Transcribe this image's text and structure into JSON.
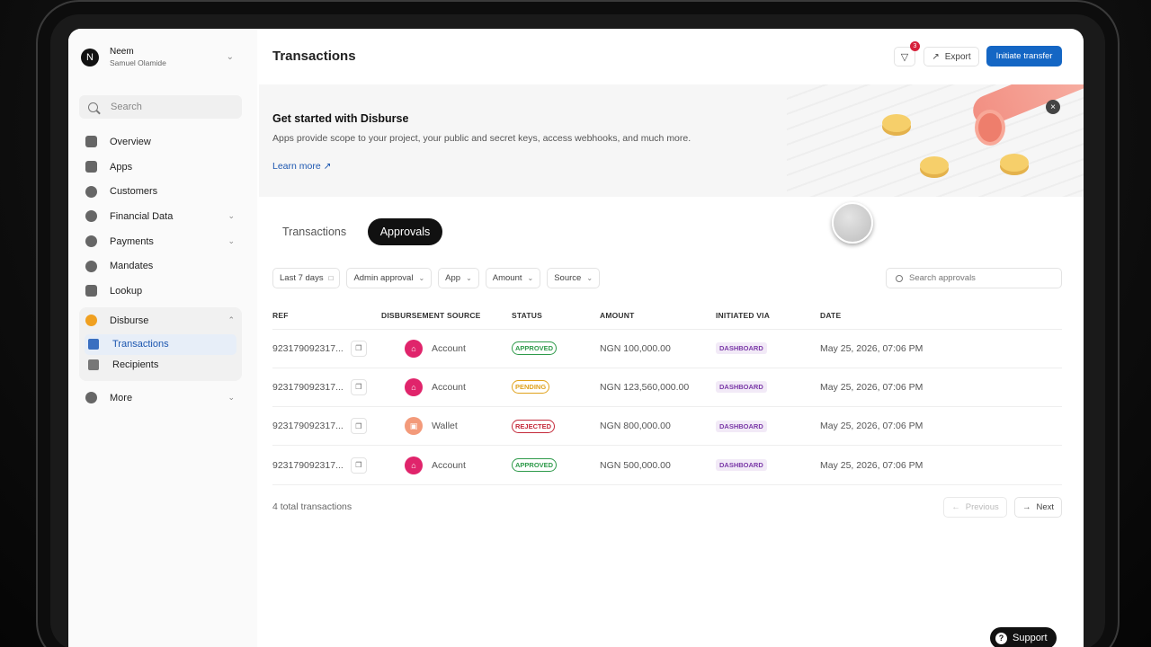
{
  "org": {
    "initial": "N",
    "name": "Neem",
    "user": "Samuel Olamide"
  },
  "sidebar": {
    "search_placeholder": "Search",
    "items": [
      {
        "label": "Overview"
      },
      {
        "label": "Apps"
      },
      {
        "label": "Customers"
      },
      {
        "label": "Financial Data"
      },
      {
        "label": "Payments"
      },
      {
        "label": "Mandates"
      },
      {
        "label": "Lookup"
      }
    ],
    "group": {
      "label": "Disburse",
      "children": [
        {
          "label": "Transactions"
        },
        {
          "label": "Recipients"
        }
      ]
    },
    "more": "More"
  },
  "header": {
    "title": "Transactions",
    "notification_count": "3",
    "export_label": "Export",
    "initiate_label": "Initiate transfer"
  },
  "banner": {
    "title": "Get started with Disburse",
    "description": "Apps provide scope to your project, your public and secret keys, access webhooks, and much more.",
    "link": "Learn more"
  },
  "tabs": [
    {
      "label": "Transactions"
    },
    {
      "label": "Approvals"
    }
  ],
  "filters": [
    {
      "label": "Last 7 days"
    },
    {
      "label": "Admin approval"
    },
    {
      "label": "App"
    },
    {
      "label": "Amount"
    },
    {
      "label": "Source"
    }
  ],
  "search_approvals_placeholder": "Search approvals",
  "table": {
    "columns": [
      "REF",
      "DISBURSEMENT SOURCE",
      "STATUS",
      "AMOUNT",
      "INITIATED VIA",
      "DATE"
    ],
    "rows": [
      {
        "ref": "923179092317...",
        "source": "Account",
        "status": "APPROVED",
        "amount": "NGN 100,000.00",
        "via": "DASHBOARD",
        "date": "May 25, 2026, 07:06 PM"
      },
      {
        "ref": "923179092317...",
        "source": "Account",
        "status": "PENDING",
        "amount": "NGN 123,560,000.00",
        "via": "DASHBOARD",
        "date": "May 25, 2026, 07:06 PM"
      },
      {
        "ref": "923179092317...",
        "source": "Wallet",
        "status": "REJECTED",
        "amount": "NGN 800,000.00",
        "via": "DASHBOARD",
        "date": "May 25, 2026, 07:06 PM"
      },
      {
        "ref": "923179092317...",
        "source": "Account",
        "status": "APPROVED",
        "amount": "NGN 500,000.00",
        "via": "DASHBOARD",
        "date": "May 25, 2026, 07:06 PM"
      }
    ]
  },
  "footer": {
    "total": "4 total transactions",
    "previous": "Previous",
    "next": "Next"
  },
  "support_label": "Support",
  "colors": {
    "approved": "#2e9a4a",
    "pending": "#e0a21c",
    "rejected": "#c42a3a",
    "account_icon": "#e0246b",
    "wallet_icon": "#f39a7a",
    "brand": "#1466c4"
  }
}
